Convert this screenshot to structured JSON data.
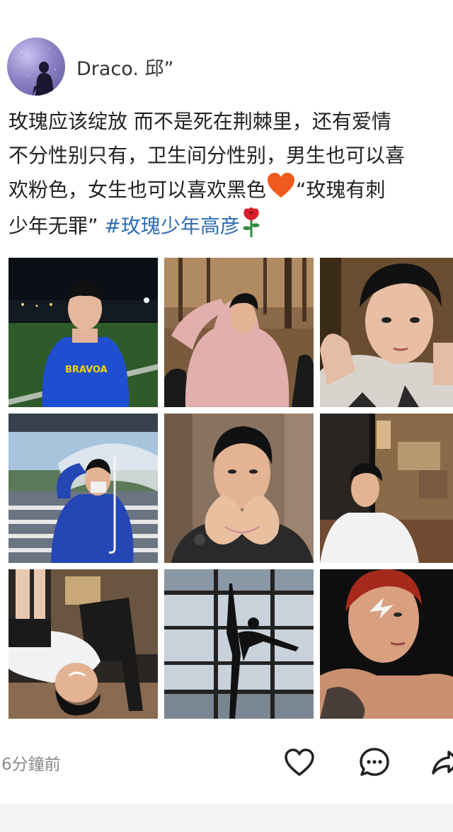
{
  "post": {
    "author": "Draco. 邱”",
    "text_lines": [
      "玫瑰应该绽放 而不是死在荆棘里，还有爱情",
      "不分性别只有，卫生间分性别，男生也可以喜",
      "欢粉色，女生也可以喜欢黑色",
      "“玫瑰有刺",
      "少年无罪”",
      "#玫瑰少年高彦"
    ],
    "timestamp": "6分鐘前"
  },
  "photos": [
    {
      "alt": "boy-in-blue-hoodie-night-field"
    },
    {
      "alt": "boy-in-pink-hoodie-forest"
    },
    {
      "alt": "boy-closeup-grey-sweatshirt"
    },
    {
      "alt": "boy-with-clear-umbrella-street"
    },
    {
      "alt": "boy-heart-hands"
    },
    {
      "alt": "boy-white-sweater-cafe"
    },
    {
      "alt": "boy-upside-down-chair"
    },
    {
      "alt": "dancer-silhouette-window"
    },
    {
      "alt": "boy-face-paint-tattoo"
    }
  ],
  "icons": {
    "like": "heart-icon",
    "comment": "comment-icon",
    "share": "share-icon",
    "heart_emoji": "orange-heart-emoji",
    "rose_emoji": "rose-emoji"
  },
  "colors": {
    "hashtag": "#2f6db5",
    "timestamp": "#8a8a8a",
    "heart_emoji": "#f05a1c"
  }
}
